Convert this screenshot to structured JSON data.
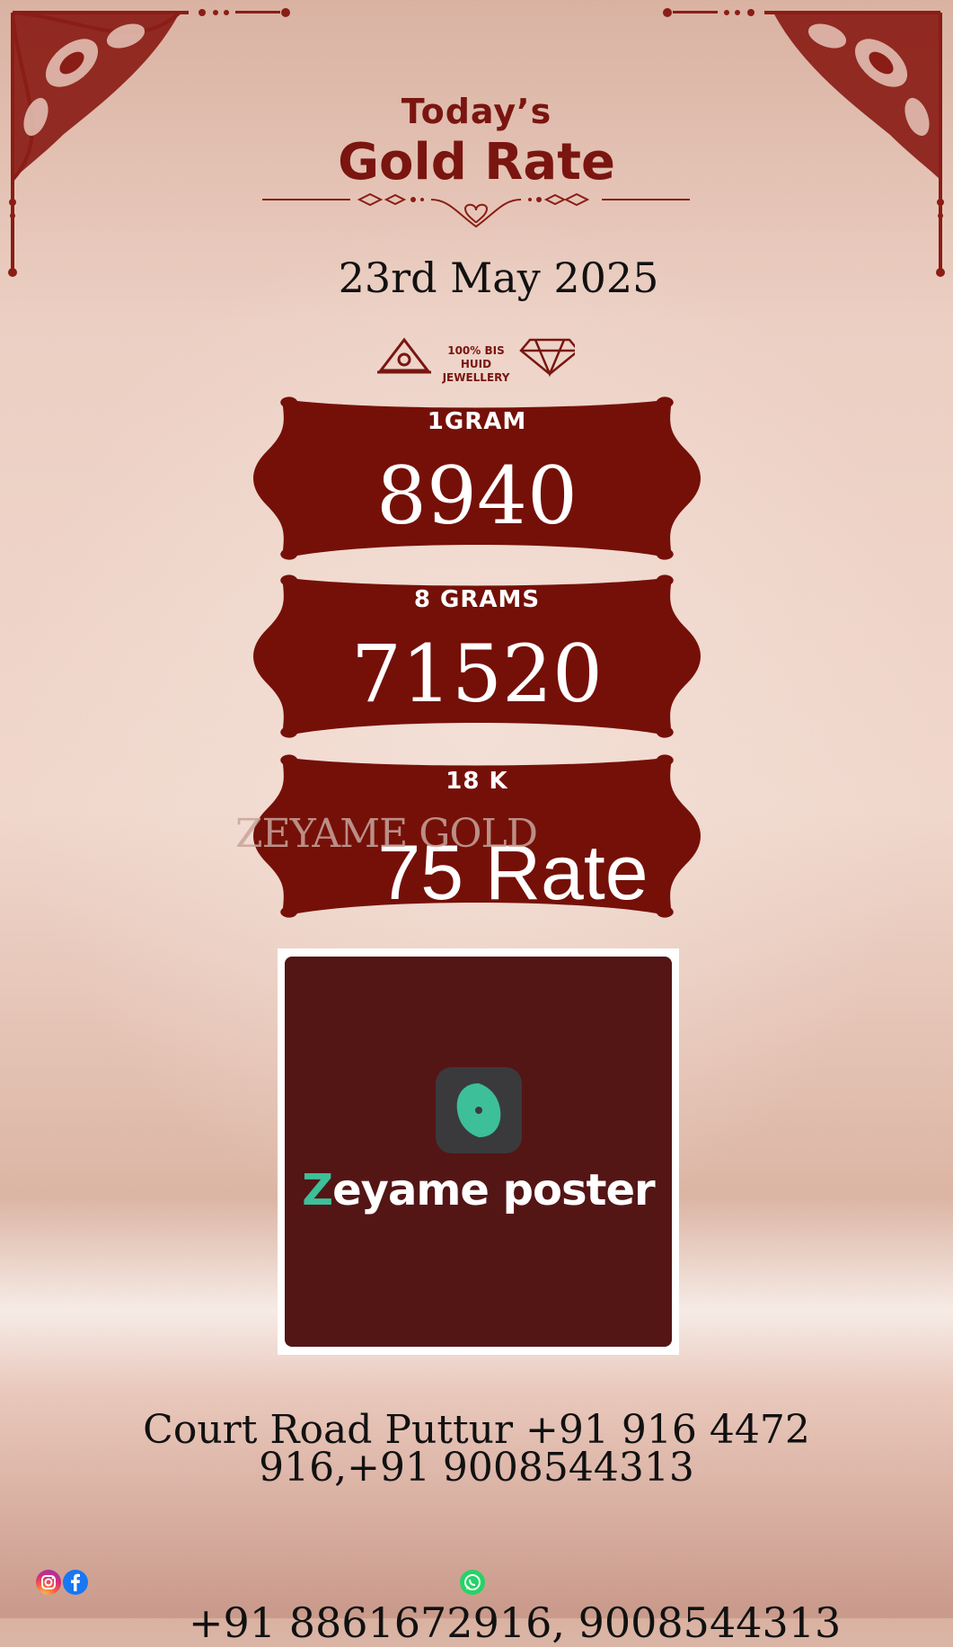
{
  "header": {
    "title_line1": "Today’s",
    "title_line2": "Gold Rate",
    "date": "23rd May 2025"
  },
  "hallmark": {
    "line1": "100% BIS HUID",
    "line2": "JEWELLERY"
  },
  "rates": [
    {
      "label": "1GRAM",
      "value": "8940"
    },
    {
      "label": "8 GRAMS",
      "value": "71520"
    },
    {
      "label": "18 K",
      "value": "75 Rate"
    }
  ],
  "watermark": "ZEYAME GOLD",
  "poster": {
    "brand_first": "Z",
    "brand_rest": "eyame poster",
    "icon": "zeyame-logo-icon"
  },
  "address": {
    "line1": "Court Road Puttur +91 916 4472",
    "line2": "916,+91 9008544313"
  },
  "footer": {
    "icons": [
      "instagram-icon",
      "facebook-icon",
      "whatsapp-icon"
    ],
    "phone": "+91 8861672916, 9008544313"
  },
  "colors": {
    "maroon": "#7a1510",
    "poster_bg": "#541515",
    "accent_green": "#3dbf9a"
  }
}
